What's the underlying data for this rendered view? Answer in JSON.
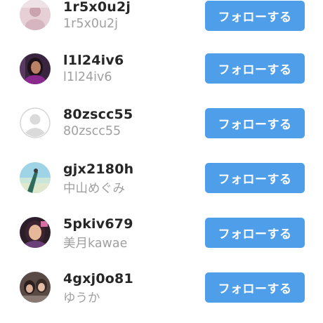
{
  "users": [
    {
      "username": "1r5x0u2j",
      "fullname": "1r5x0u2j",
      "avatar": "profile-photo-pink",
      "follow_label": "フォローする"
    },
    {
      "username": "l1l24iv6",
      "fullname": "l1l24iv6",
      "avatar": "profile-photo-purple",
      "follow_label": "フォローする"
    },
    {
      "username": "80zscc55",
      "fullname": "80zscc55",
      "avatar": "default-avatar-icon",
      "follow_label": "フォローする"
    },
    {
      "username": "gjx2180h",
      "fullname": "中山めぐみ",
      "avatar": "profile-photo-beach",
      "follow_label": "フォローする"
    },
    {
      "username": "5pkiv679",
      "fullname": "美月kawae",
      "avatar": "profile-photo-woman",
      "follow_label": "フォローする"
    },
    {
      "username": "4gxj0o81",
      "fullname": "ゆうか",
      "avatar": "profile-photo-group",
      "follow_label": "フォローする"
    }
  ],
  "colors": {
    "button": "#4f9eea",
    "username": "#262626",
    "fullname": "#a0a0a0"
  }
}
